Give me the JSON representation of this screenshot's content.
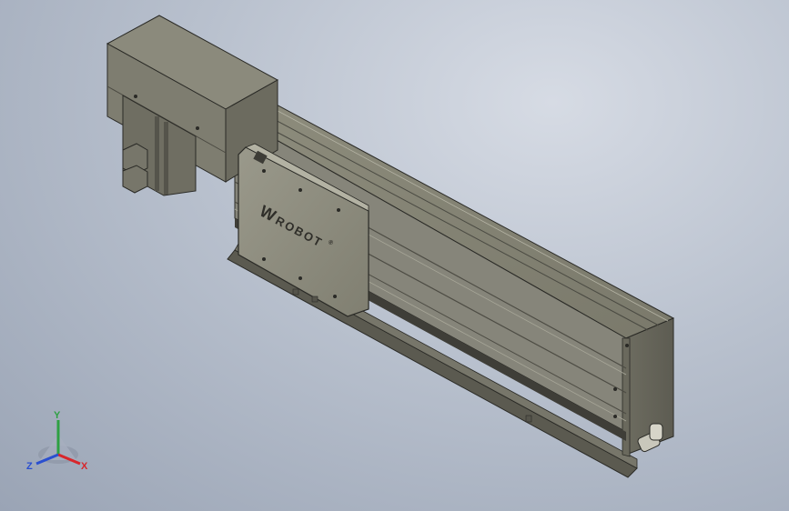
{
  "carriage": {
    "logo_mark": "W",
    "logo_text": "ROBOT",
    "trademark": "®"
  },
  "triad": {
    "x_label": "X",
    "y_label": "Y",
    "z_label": "Z",
    "colors": {
      "x": "#d8262b",
      "y": "#2ea043",
      "z": "#2a4fd0"
    }
  }
}
